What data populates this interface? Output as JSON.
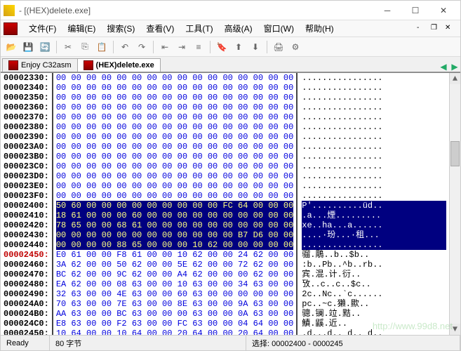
{
  "window": {
    "title": " - [(HEX)delete.exe]"
  },
  "menu": {
    "file": "文件(F)",
    "edit": "编辑(E)",
    "search": "搜索(S)",
    "view": "查看(V)",
    "tools": "工具(T)",
    "advanced": "高级(A)",
    "window": "窗口(W)",
    "help": "帮助(H)"
  },
  "tabs": {
    "t1": "Enjoy C32asm",
    "t2": "(HEX)delete.exe"
  },
  "status": {
    "ready": "Ready",
    "bytes": "80 字节",
    "sel": "选择: 00002400 - 0000245"
  },
  "watermark": "http://www.99d8.net",
  "hex": {
    "addrs": [
      "00002330:",
      "00002340:",
      "00002350:",
      "00002360:",
      "00002370:",
      "00002380:",
      "00002390:",
      "000023A0:",
      "000023B0:",
      "000023C0:",
      "000023D0:",
      "000023E0:",
      "000023F0:",
      "00002400:",
      "00002410:",
      "00002420:",
      "00002430:",
      "00002440:",
      "00002450:",
      "00002460:",
      "00002470:",
      "00002480:",
      "00002490:",
      "000024A0:",
      "000024B0:",
      "000024C0:",
      "00002450:"
    ],
    "selAddrIdx": 18,
    "rows": [
      {
        "b": "00 00 00 00 00 00 00 00 00 00 00 00 00 00 00 00",
        "a": "................"
      },
      {
        "b": "00 00 00 00 00 00 00 00 00 00 00 00 00 00 00 00",
        "a": "................"
      },
      {
        "b": "00 00 00 00 00 00 00 00 00 00 00 00 00 00 00 00",
        "a": "................"
      },
      {
        "b": "00 00 00 00 00 00 00 00 00 00 00 00 00 00 00 00",
        "a": "................"
      },
      {
        "b": "00 00 00 00 00 00 00 00 00 00 00 00 00 00 00 00",
        "a": "................"
      },
      {
        "b": "00 00 00 00 00 00 00 00 00 00 00 00 00 00 00 00",
        "a": "................"
      },
      {
        "b": "00 00 00 00 00 00 00 00 00 00 00 00 00 00 00 00",
        "a": "................"
      },
      {
        "b": "00 00 00 00 00 00 00 00 00 00 00 00 00 00 00 00",
        "a": "................"
      },
      {
        "b": "00 00 00 00 00 00 00 00 00 00 00 00 00 00 00 00",
        "a": "................"
      },
      {
        "b": "00 00 00 00 00 00 00 00 00 00 00 00 00 00 00 00",
        "a": "................"
      },
      {
        "b": "00 00 00 00 00 00 00 00 00 00 00 00 00 00 00 00",
        "a": "................"
      },
      {
        "b": "00 00 00 00 00 00 00 00 00 00 00 00 00 00 00 00",
        "a": "................"
      },
      {
        "b": "00 00 00 00 00 00 00 00 00 00 00 00 00 00 00 00",
        "a": "................"
      },
      {
        "b": "50 60 00 00 00 00 00 00 00 00 00 FC 64 00 00 00",
        "a": "P'..........üd..",
        "hl": true
      },
      {
        "b": "18 61 00 00 00 60 00 00 00 00 00 00 00 00 00 00",
        "a": ".a...煙.........",
        "hl": true
      },
      {
        "b": "78 65 00 00 68 61 00 00 00 00 00 00 00 00 00 00",
        "a": "xe..ha...a......",
        "hl": true
      },
      {
        "b": "00 00 00 00 00 00 00 00 00 00 00 00 B7 D6 00 00",
        "a": "....·玢...·租...",
        "hl": true
      },
      {
        "b": "00 00 00 00 88 65 00 00 00 10 62 00 00 00 00 00",
        "a": "................",
        "hl": true
      },
      {
        "b": "E0 61 00 00 F8 61 00 00 10 62 00 00 24 62 00 00",
        "a": "骝.鵰..b..$b.."
      },
      {
        "b": "3A 62 00 00 50 62 00 00 5E 62 00 00 72 62 00 00",
        "a": ":b..Pb..^b..rb.."
      },
      {
        "b": "BC 62 00 00 9C 62 00 00 A4 62 00 00 00 62 00 00",
        "a": "宾.混.计.衍.."
      },
      {
        "b": "EA 62 00 00 08 63 00 00 10 63 00 00 34 63 00 00",
        "a": "攷..c..c..$c.."
      },
      {
        "b": "32 63 00 00 4E 63 00 00 60 63 00 00 00 00 00 00",
        "a": "2c..Nc..`c......"
      },
      {
        "b": "70 63 00 00 7E 63 00 00 8E 63 00 00 9A 63 00 00",
        "a": "pc..~c.獺.歞.."
      },
      {
        "b": "AA 63 00 00 BC 63 00 00 00 63 00 00 0A 63 00 00",
        "a": "骢.镧.竝.黠.."
      },
      {
        "b": "E8 63 00 00 F2 63 00 00 FC 63 00 00 04 64 00 00",
        "a": "鰿.鼷.近.."
      },
      {
        "b": "10 64 00 00 10 64 00 00 20 64 00 00 20 64 00 00",
        "a": ".d...d.. d.. d.."
      }
    ]
  }
}
